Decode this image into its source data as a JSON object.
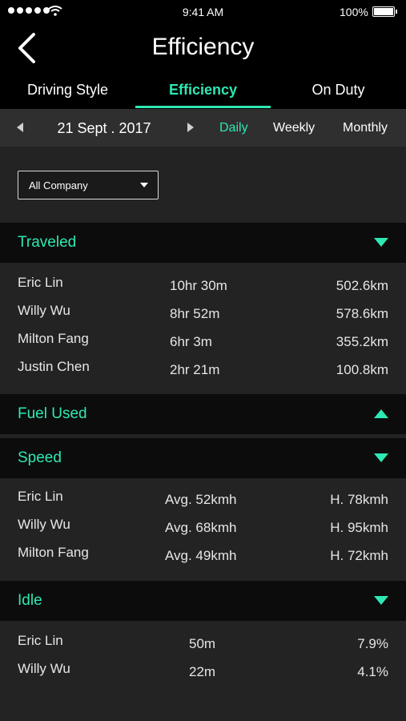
{
  "status": {
    "time": "9:41 AM",
    "battery": "100%",
    "battery_level": 1.0
  },
  "header": {
    "title": "Efficiency"
  },
  "tabs": [
    {
      "label": "Driving Style"
    },
    {
      "label": "Efficiency"
    },
    {
      "label": "On Duty"
    }
  ],
  "datebar": {
    "date": "21 Sept . 2017",
    "periods": [
      {
        "label": "Daily"
      },
      {
        "label": "Weekly"
      },
      {
        "label": "Monthly"
      }
    ]
  },
  "filter": {
    "selected": "All Company"
  },
  "sections": {
    "traveled": {
      "title": "Traveled",
      "rows": [
        {
          "name": "Eric Lin",
          "time": "10hr  30m",
          "distance": "502.6km"
        },
        {
          "name": "Willy Wu",
          "time": "8hr  52m",
          "distance": "578.6km"
        },
        {
          "name": "Milton Fang",
          "time": "6hr  3m",
          "distance": "355.2km"
        },
        {
          "name": "Justin Chen",
          "time": "2hr  21m",
          "distance": "100.8km"
        }
      ]
    },
    "fuel": {
      "title": "Fuel Used"
    },
    "speed": {
      "title": "Speed",
      "rows": [
        {
          "name": "Eric Lin",
          "avg": "Avg. 52kmh",
          "high": "H. 78kmh"
        },
        {
          "name": "Willy Wu",
          "avg": "Avg. 68kmh",
          "high": "H. 95kmh"
        },
        {
          "name": "Milton Fang",
          "avg": "Avg. 49kmh",
          "high": "H. 72kmh"
        }
      ]
    },
    "idle": {
      "title": "Idle",
      "rows": [
        {
          "name": "Eric Lin",
          "duration": "50m",
          "percent": "7.9%"
        },
        {
          "name": "Willy Wu",
          "duration": "22m",
          "percent": "4.1%"
        }
      ]
    }
  },
  "colors": {
    "accent": "#2ee8b3",
    "background": "#1d1d1d",
    "header": "#000000"
  }
}
